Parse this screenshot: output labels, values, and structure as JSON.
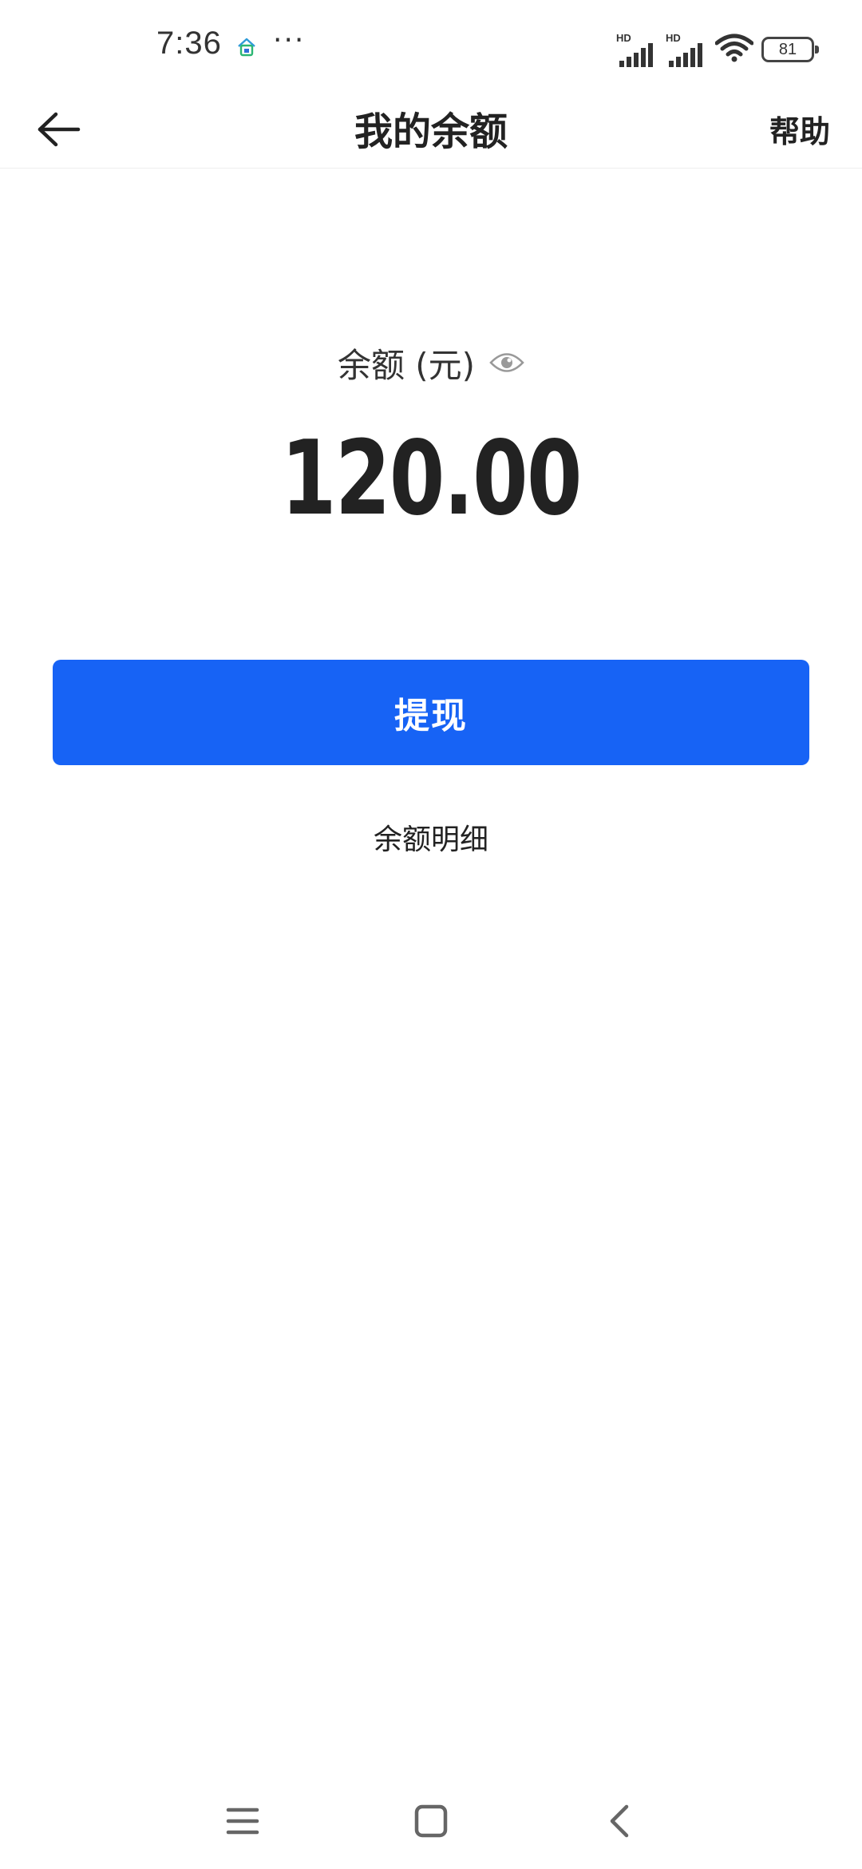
{
  "status_bar": {
    "time": "7:36",
    "more": "···",
    "signal_1_label": "HD",
    "signal_2_label": "HD",
    "battery": "81",
    "icons": [
      "home-app-icon",
      "signal-icon",
      "signal-icon",
      "wifi-icon",
      "battery-icon"
    ]
  },
  "header": {
    "title": "我的余额",
    "help_label": "帮助",
    "back_icon": "arrow-left-icon"
  },
  "balance": {
    "label": "余额 (元)",
    "amount": "120.00",
    "visibility_icon": "eye-icon"
  },
  "actions": {
    "withdraw_label": "提现",
    "detail_label": "余额明细"
  },
  "nav": {
    "icons": [
      "menu-icon",
      "home-icon",
      "back-icon"
    ]
  },
  "colors": {
    "accent": "#1763f5",
    "text": "#222222"
  }
}
